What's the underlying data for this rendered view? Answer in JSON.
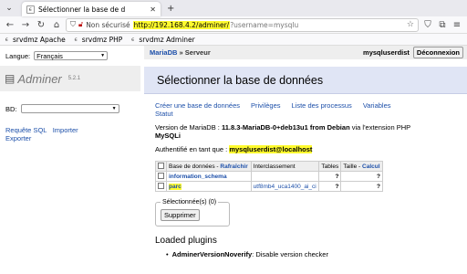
{
  "browser": {
    "tab_title": "Sélectionner la base de d",
    "url_insecure": "Non sécurisé",
    "url_host": "http://192.168.4.2/adminer/",
    "url_rest": "?username=mysqlu",
    "bookmarks": [
      "srvdmz Apache",
      "srvdmz PHP",
      "srvdmz Adminer"
    ]
  },
  "sidebar": {
    "lang_label": "Langue:",
    "lang_value": "Français",
    "app_name": "Adminer",
    "version": "5.2.1",
    "db_label": "BD:",
    "db_value": "",
    "link_sql": "Requête SQL",
    "link_import": "Importer",
    "link_export": "Exporter"
  },
  "header": {
    "crumb_server": "MariaDB",
    "crumb_sep": "»",
    "crumb_current": "Serveur",
    "user": "mysqluserdist",
    "logout": "Déconnexion",
    "title": "Sélectionner la base de données"
  },
  "links": [
    "Créer une base de données",
    "Privilèges",
    "Liste des processus",
    "Variables",
    "Statut"
  ],
  "version_info": {
    "prefix": "Version de MariaDB :",
    "version": "11.8.3-MariaDB-0+deb13u1 from Debian",
    "via": "via l'extension PHP",
    "ext": "MySQLi"
  },
  "auth": {
    "label": "Authentifié en tant que :",
    "user": "mysqluserdist@localhost"
  },
  "table": {
    "col_db": "Base de données",
    "col_sep": "-",
    "col_refresh": "Rafraîchir",
    "col_collation": "Interclassement",
    "col_tables": "Tables",
    "col_size": "Taille",
    "col_calc": "Calcul",
    "rows": [
      {
        "name": "information_schema",
        "collation": "",
        "tables": "?",
        "size": "?"
      },
      {
        "name": "parc",
        "collation": "utf8mb4_uca1400_ai_ci",
        "tables": "?",
        "size": "?"
      }
    ]
  },
  "selection": {
    "legend": "Sélectionnée(s) (0)",
    "delete": "Supprimer"
  },
  "plugins": {
    "title": "Loaded plugins",
    "item_name": "AdminerVersionNoverify",
    "item_desc": ": Disable version checker"
  }
}
